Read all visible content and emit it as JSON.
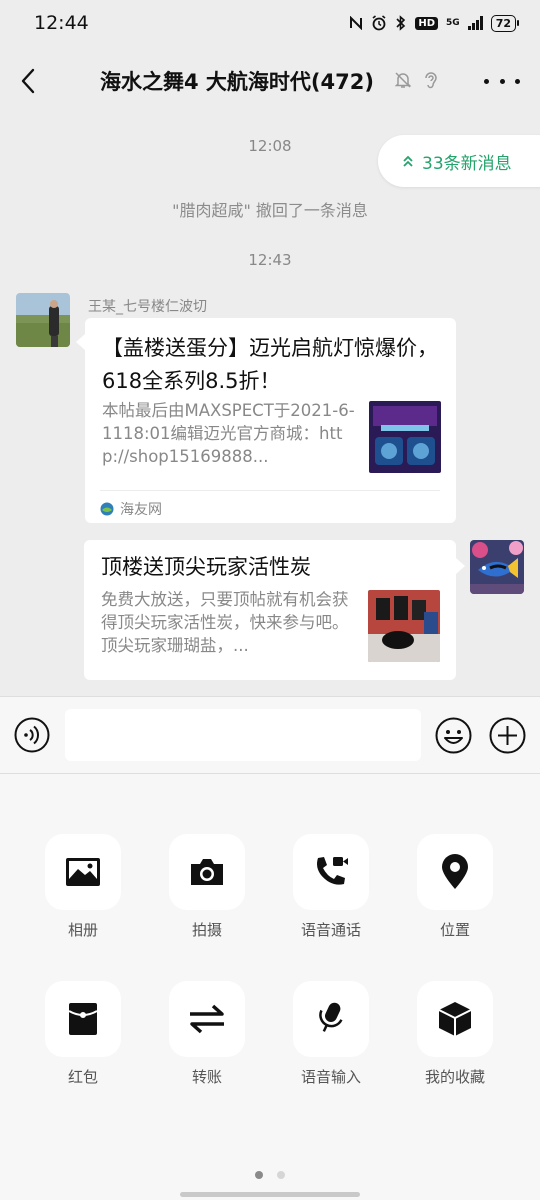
{
  "status_bar": {
    "time": "12:44",
    "hd_label": "HD",
    "network_label": "5G",
    "battery": "72"
  },
  "header": {
    "title": "海水之舞4 大航海时代(472)"
  },
  "chat": {
    "time_1": "12:08",
    "recall_notice": "\"腊肉超咸\" 撤回了一条消息",
    "time_2": "12:43",
    "new_messages_label": "33条新消息",
    "sender_name": "王某_七号楼仁波切",
    "card_1": {
      "title": "【盖楼送蛋分】迈光启航灯惊爆价，618全系列8.5折！",
      "description": "本帖最后由MAXSPECT于2021-6-1118:01编辑迈光官方商城：http://shop15169888...",
      "source": "海友网"
    },
    "card_2": {
      "title": "顶楼送顶尖玩家活性炭",
      "description": "免费大放送，只要顶帖就有机会获得顶尖玩家活性炭，快来参与吧。顶尖玩家珊瑚盐，..."
    }
  },
  "input_bar": {
    "placeholder": ""
  },
  "panel": {
    "tools": [
      {
        "label": "相册",
        "icon": "photo-album-icon"
      },
      {
        "label": "拍摄",
        "icon": "camera-icon"
      },
      {
        "label": "语音通话",
        "icon": "voice-call-icon"
      },
      {
        "label": "位置",
        "icon": "location-icon"
      },
      {
        "label": "红包",
        "icon": "red-packet-icon"
      },
      {
        "label": "转账",
        "icon": "transfer-icon"
      },
      {
        "label": "语音输入",
        "icon": "voice-input-icon"
      },
      {
        "label": "我的收藏",
        "icon": "favorites-icon"
      }
    ],
    "page_indicator": {
      "current": 1,
      "total": 2
    }
  },
  "colors": {
    "background": "#ededed",
    "accent_green": "#24a36b",
    "card": "#ffffff"
  }
}
